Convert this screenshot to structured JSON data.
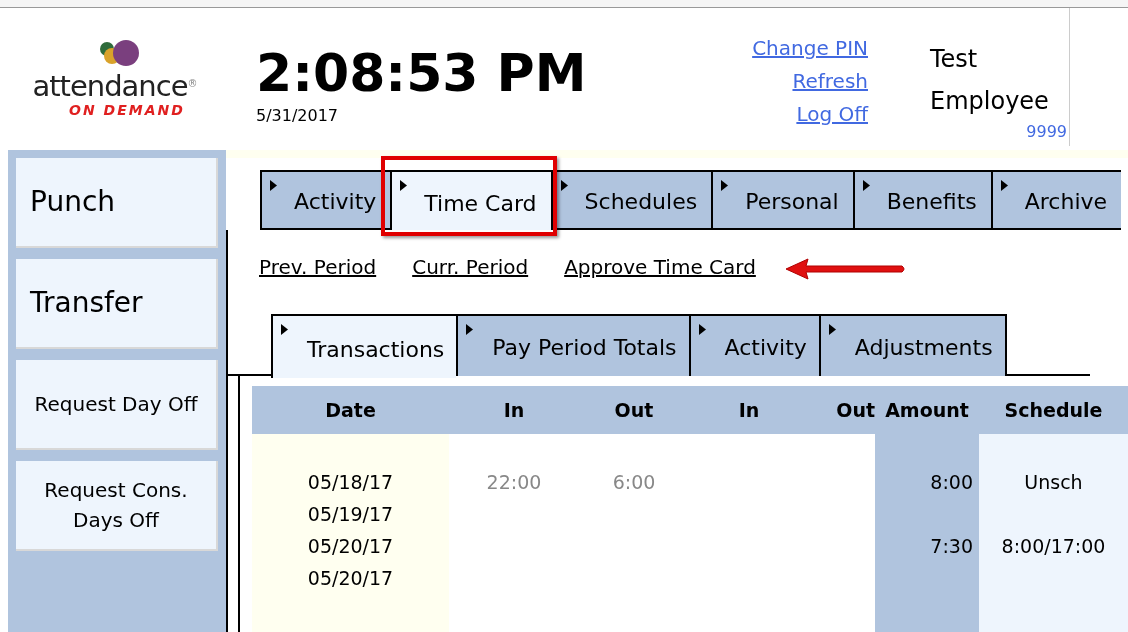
{
  "logo": {
    "wordmark": "attendance",
    "mark": "®",
    "tagline": "ON DEMAND"
  },
  "clock": {
    "time": "2:08:53 PM",
    "date": "5/31/2017"
  },
  "links": [
    "Change PIN",
    "Refresh",
    "Log Off"
  ],
  "user": {
    "name": "Test Employee",
    "id": "9999"
  },
  "sidebar": {
    "items": [
      "Punch",
      "Transfer",
      "Request Day Off",
      "Request Cons. Days Off"
    ]
  },
  "tabs": [
    {
      "label": "Activity",
      "selected": false,
      "highlighted": false
    },
    {
      "label": "Time Card",
      "selected": true,
      "highlighted": true
    },
    {
      "label": "Schedules",
      "selected": false,
      "highlighted": false
    },
    {
      "label": "Personal",
      "selected": false,
      "highlighted": false
    },
    {
      "label": "Benefits",
      "selected": false,
      "highlighted": false
    },
    {
      "label": "Archive",
      "selected": false,
      "highlighted": false
    }
  ],
  "period_links": [
    "Prev. Period",
    "Curr. Period",
    "Approve Time Card"
  ],
  "subtabs": [
    {
      "label": "Transactions",
      "selected": true
    },
    {
      "label": "Pay Period Totals",
      "selected": false
    },
    {
      "label": "Activity",
      "selected": false
    },
    {
      "label": "Adjustments",
      "selected": false
    }
  ],
  "table": {
    "columns": [
      {
        "label": "Date",
        "kind": "date"
      },
      {
        "label": "In",
        "kind": "punch"
      },
      {
        "label": "Out",
        "kind": "punch"
      },
      {
        "label": "In",
        "kind": "punch"
      },
      {
        "label": "Out",
        "kind": "punch_end"
      },
      {
        "label": "Amount",
        "kind": "total"
      },
      {
        "label": "Schedule",
        "kind": "schedule"
      }
    ],
    "rows": [
      {
        "date": "05/18/17",
        "in_1": "22:00",
        "out_1": "6:00",
        "amount": "8:00",
        "schedule": "Unsch"
      },
      {
        "date": "05/19/17"
      },
      {
        "date": "05/20/17",
        "amount": "7:30",
        "schedule": "8:00/17:00"
      },
      {
        "date": "05/20/17"
      }
    ]
  }
}
